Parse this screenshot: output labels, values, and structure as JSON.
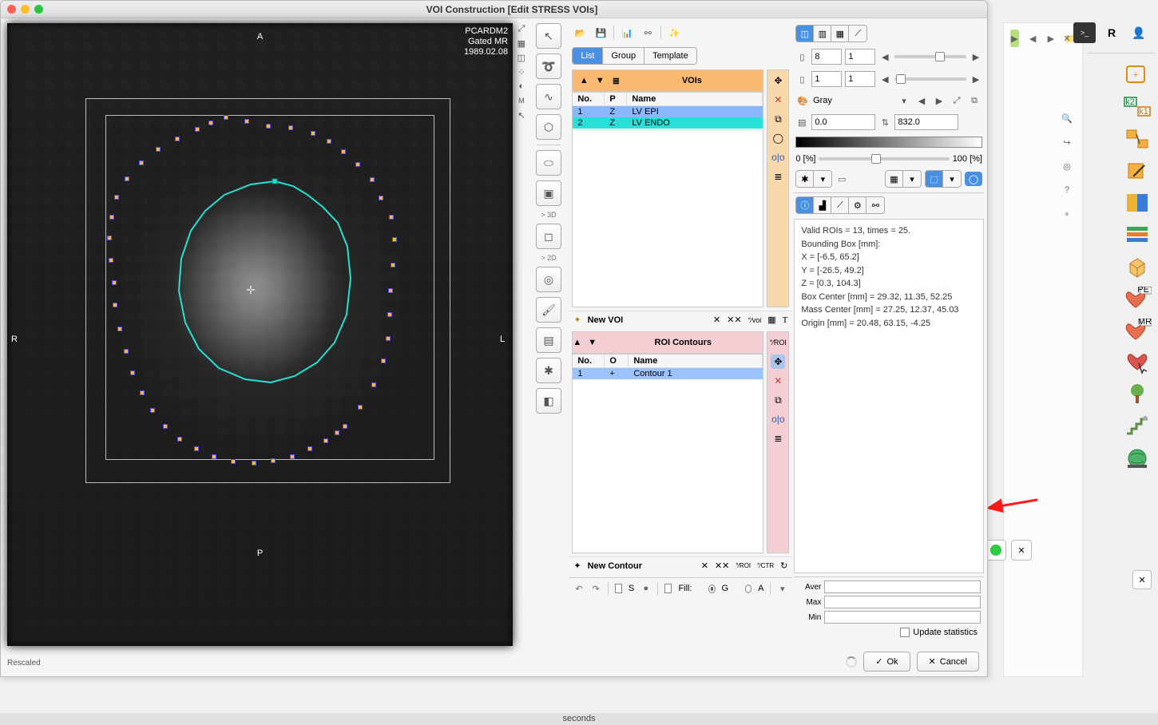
{
  "window": {
    "title": "VOI Construction [Edit STRESS VOIs]"
  },
  "viewport": {
    "patient_id": "PCARDM2",
    "study": "Gated MR",
    "date": "1989.02.08",
    "orient_top": "A",
    "orient_bottom": "P",
    "orient_left": "R",
    "orient_right": "L",
    "status": "Rescaled",
    "seconds_label": "seconds"
  },
  "tool_labels": {
    "label_3d": "> 3D",
    "label_2d": "> 2D"
  },
  "tabs": {
    "list": "List",
    "group": "Group",
    "template": "Template"
  },
  "voi": {
    "header": "VOIs",
    "cols": {
      "no": "No.",
      "p": "P",
      "name": "Name"
    },
    "rows": [
      {
        "no": "1",
        "p": "Z",
        "name": "LV EPI"
      },
      {
        "no": "2",
        "p": "Z",
        "name": "LV ENDO"
      }
    ],
    "new_label": "New VOI"
  },
  "roi": {
    "header": "ROI Contours",
    "cols": {
      "no": "No.",
      "o": "O",
      "name": "Name"
    },
    "rows": [
      {
        "no": "1",
        "o": "+",
        "name": "Contour 1"
      }
    ],
    "new_label": "New Contour"
  },
  "bottom_ctrl": {
    "s_label": "S",
    "fill_label": "Fill:",
    "g_label": "G",
    "a_label": "A"
  },
  "right_panel": {
    "slice_a": "8",
    "slice_b": "1",
    "coord_a": "1",
    "coord_b": "1",
    "colormap": "Gray",
    "level_min": "0.0",
    "level_max": "832.0",
    "pct_left": "0   [%]",
    "pct_right": "100   [%]",
    "info_lines": [
      "Valid ROIs = 13, times = 25.",
      "Bounding Box [mm]:",
      "   X = [-6.5, 65.2]",
      "   Y = [-26.5, 49.2]",
      "   Z = [0.3, 104.3]",
      "Box Center [mm] = 29.32, 11.35, 52.25",
      "Mass Center [mm] = 27.25, 12.37, 45.03",
      "Origin [mm] = 20.48, 63.15, -4.25"
    ],
    "stats": {
      "aver": "Aver",
      "max": "Max",
      "min": "Min",
      "update": "Update statistics"
    }
  },
  "dialog": {
    "ok": "Ok",
    "cancel": "Cancel"
  },
  "far_right": {
    "r_label": "R",
    "pet_badge": "PET",
    "mri_badge": "MRI"
  }
}
